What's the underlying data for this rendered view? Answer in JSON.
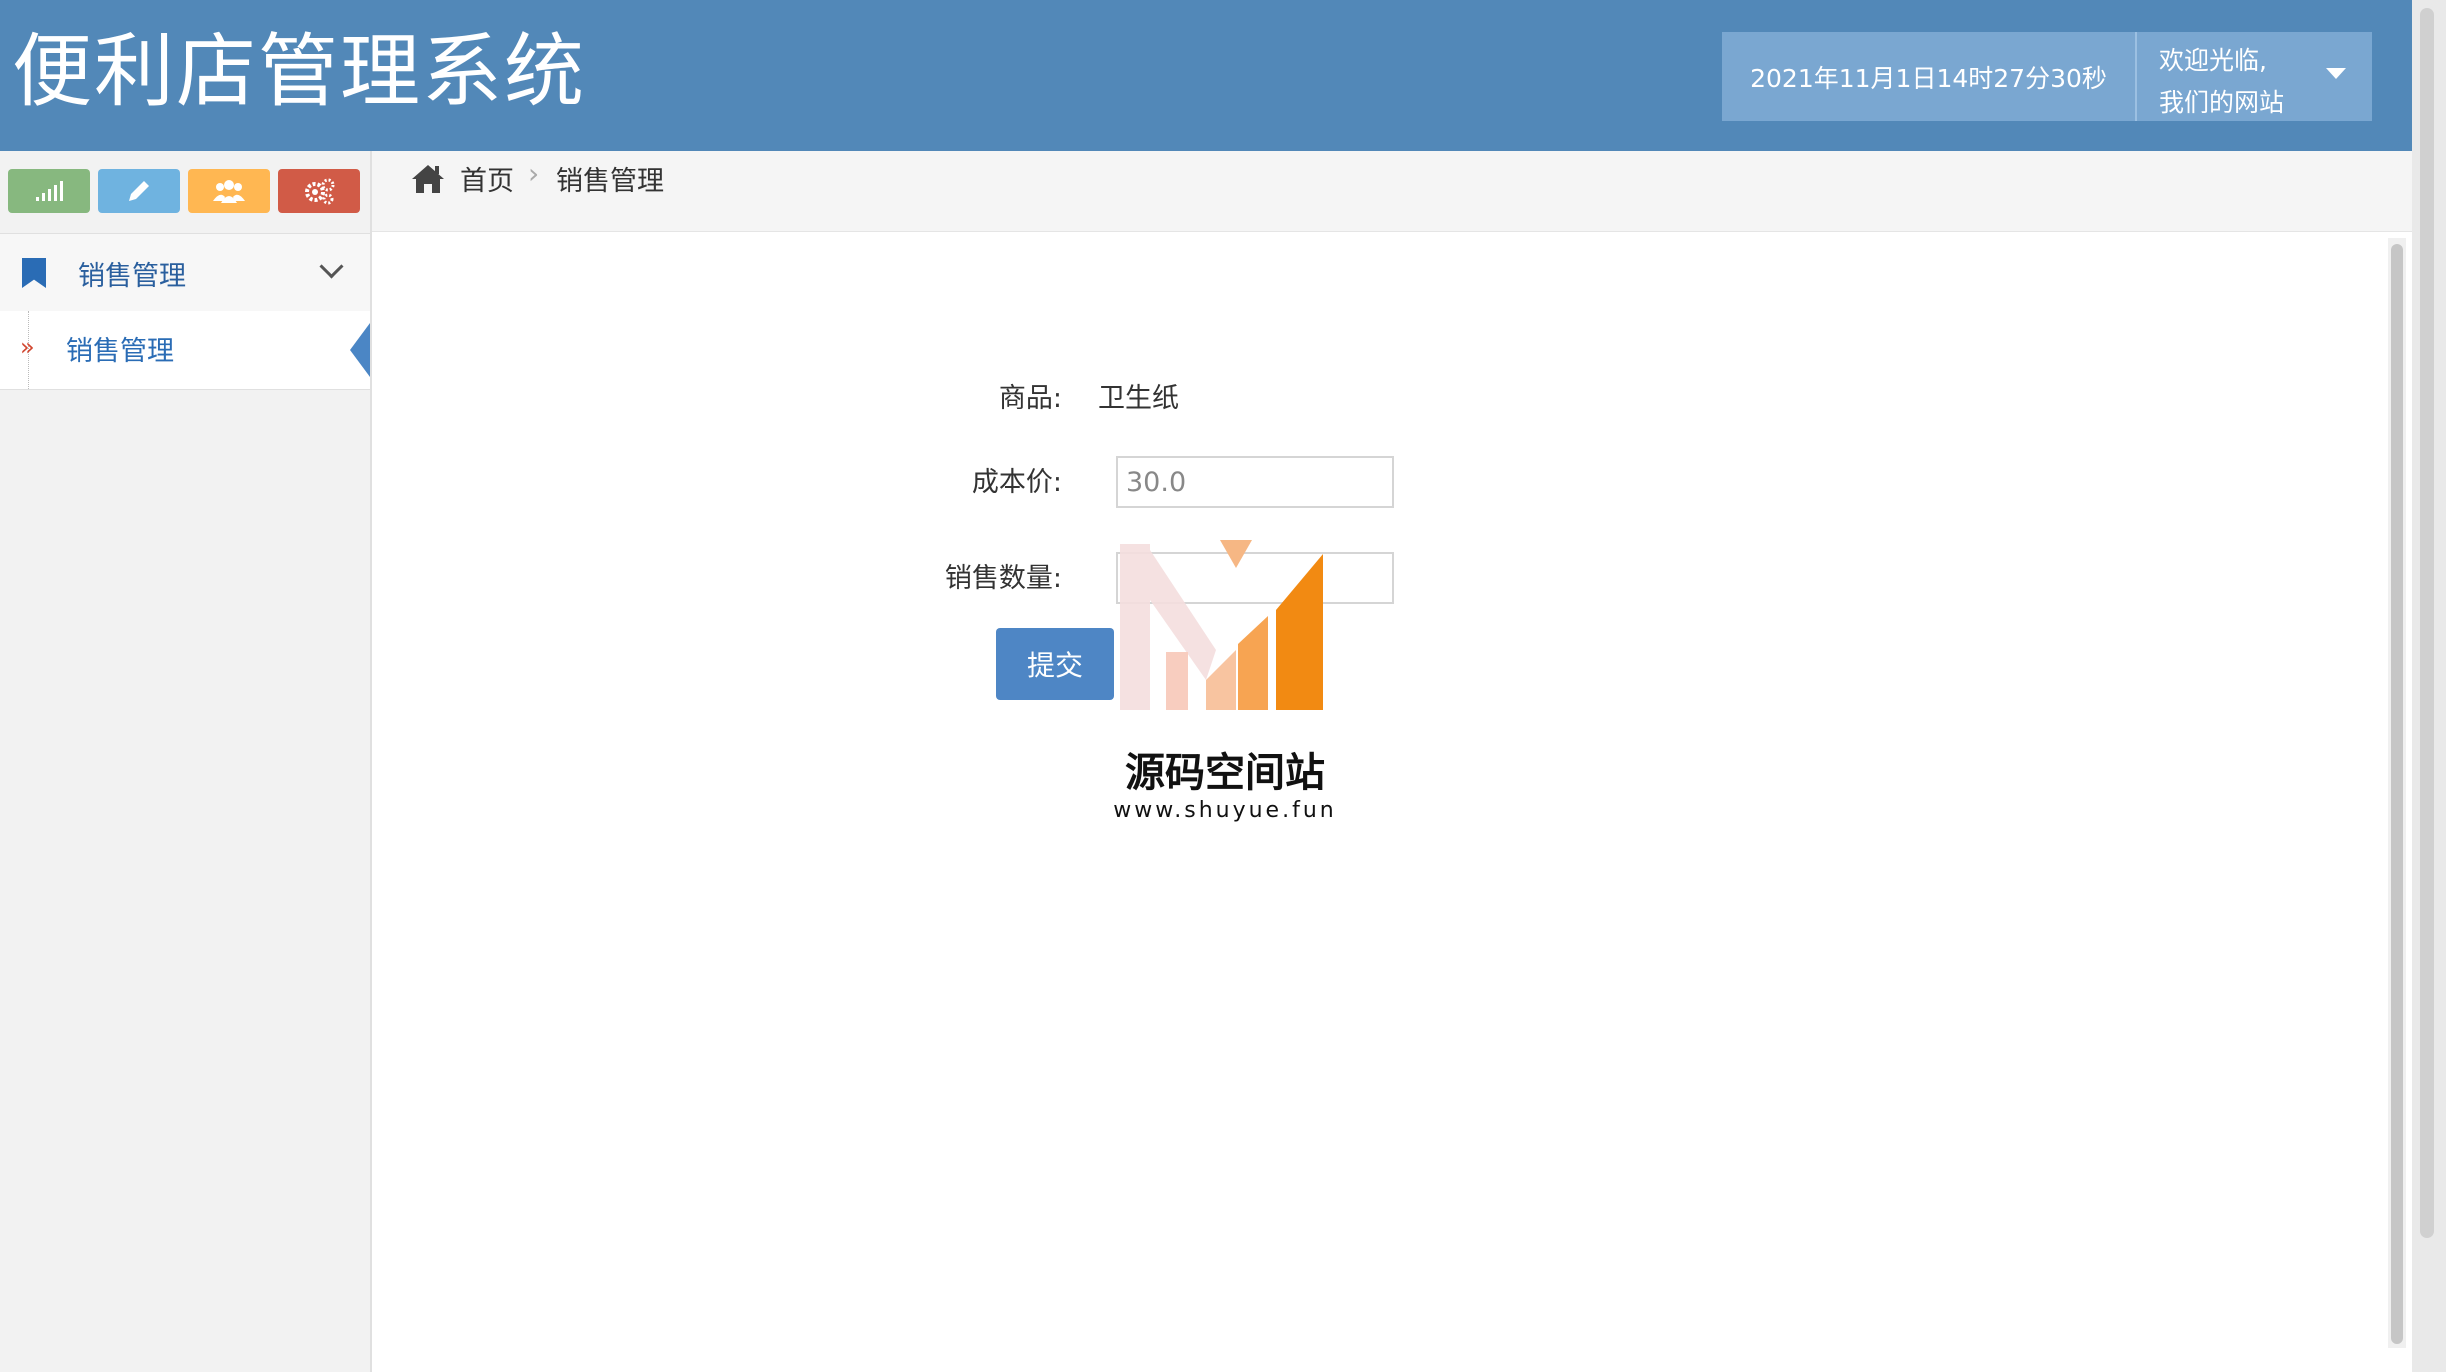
{
  "header": {
    "app_title": "便利店管理系统",
    "datetime": "2021年11月1日14时27分30秒",
    "welcome_line1": "欢迎光临,",
    "welcome_line2": "我们的网站"
  },
  "sidebar": {
    "shortcuts": [
      {
        "icon": "signal-icon",
        "color": "#87b87f"
      },
      {
        "icon": "pencil-icon",
        "color": "#6fb3e0"
      },
      {
        "icon": "users-icon",
        "color": "#ffb752"
      },
      {
        "icon": "cogs-icon",
        "color": "#d15b47"
      }
    ],
    "menu_group": "销售管理",
    "menu_item": "销售管理"
  },
  "breadcrumb": {
    "home": "首页",
    "current": "销售管理"
  },
  "form": {
    "product_label": "商品:",
    "product_value": "卫生纸",
    "cost_label": "成本价:",
    "cost_value": "30.0",
    "quantity_label": "销售数量:",
    "quantity_value": "",
    "submit_label": "提交"
  },
  "watermark": {
    "title": "源码空间站",
    "url": "www.shuyue.fun"
  }
}
